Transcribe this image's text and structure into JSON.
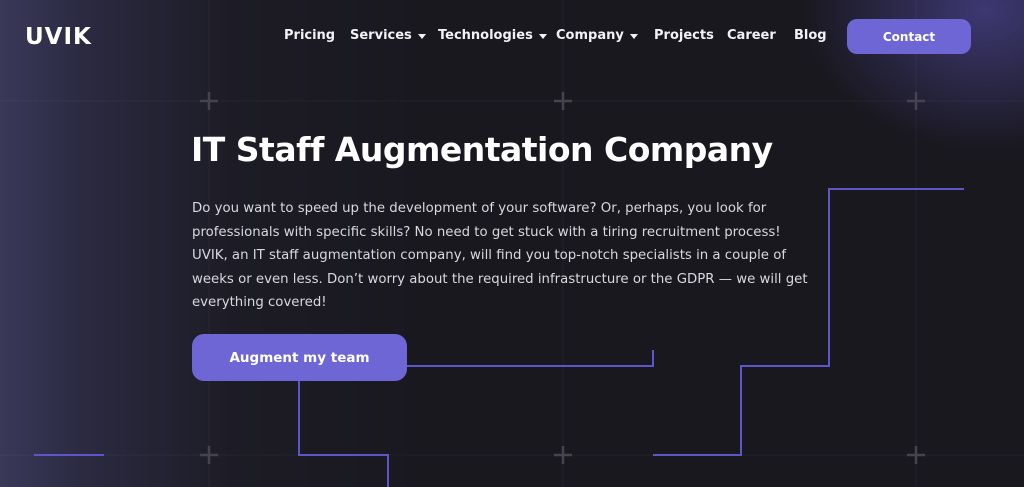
{
  "brand": {
    "logo_text": "UVIK"
  },
  "nav": {
    "items": [
      {
        "label": "Pricing",
        "has_dropdown": false
      },
      {
        "label": "Services",
        "has_dropdown": true
      },
      {
        "label": "Technologies",
        "has_dropdown": true
      },
      {
        "label": "Company",
        "has_dropdown": true
      },
      {
        "label": "Projects",
        "has_dropdown": false
      },
      {
        "label": "Career",
        "has_dropdown": false
      },
      {
        "label": "Blog",
        "has_dropdown": false
      }
    ],
    "contact_label": "Contact"
  },
  "hero": {
    "title": "IT Staff Augmentation Company",
    "description": "Do you want to speed up the development of your software? Or, perhaps, you look for professionals with specific skills? No need to get stuck with a tiring recruitment process! UVIK, an IT staff augmentation company, will find you top-notch specialists in a couple of weeks or even less. Don’t worry about the required infrastructure or the GDPR — we will get everything covered!",
    "cta_label": "Augment my team"
  },
  "colors": {
    "accent": "#6f66d6",
    "background": "#19181f",
    "circuit_line": "#5d56c9"
  },
  "icons": [
    "plus-icon",
    "chevron-down-icon"
  ]
}
